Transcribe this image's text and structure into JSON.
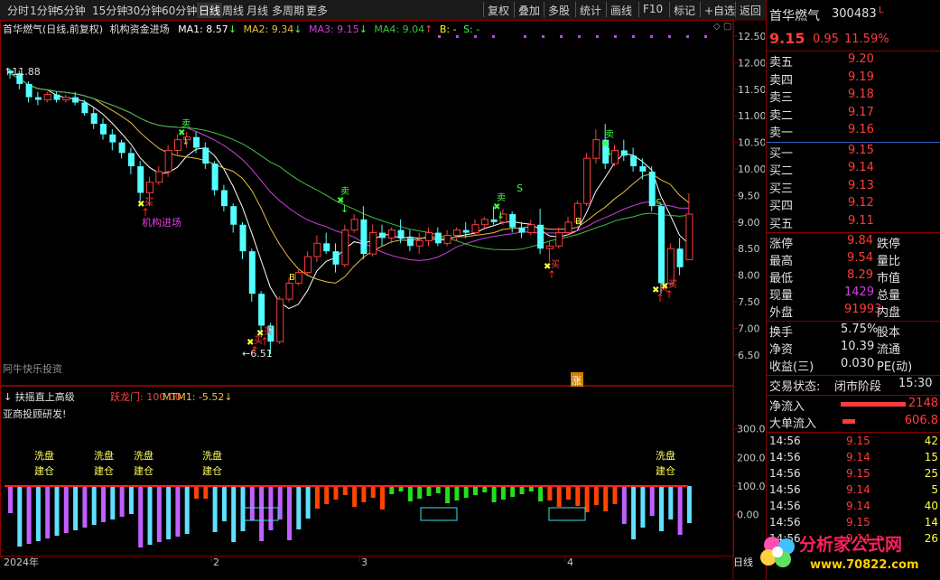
{
  "toolbar": {
    "left": [
      "分时",
      "1分钟",
      "5分钟",
      "15分钟",
      "30分钟",
      "60分钟",
      "日线",
      "周线",
      "月线",
      "多周期",
      "更多"
    ],
    "active": "日线",
    "right": [
      "复权",
      "叠加",
      "多股",
      "统计",
      "画线",
      "F10",
      "标记",
      "+自选",
      "返回"
    ]
  },
  "header": {
    "title": "首华燃气(日线,前复权)",
    "indicator": "机构资金进场",
    "ma1": "MA1: 8.57",
    "ma2": "MA2: 9.34",
    "ma3": "MA3: 9.15",
    "ma4": "MA4: 9.04",
    "b": "B: -",
    "s": "S: -"
  },
  "price_axis": [
    "12.50",
    "12.00",
    "11.50",
    "11.00",
    "10.50",
    "10.00",
    "9.50",
    "9.00",
    "8.50",
    "8.00",
    "7.50",
    "7.00",
    "6.50"
  ],
  "sub_axis": [
    "300.0",
    "200.0",
    "100.0",
    "0.00"
  ],
  "annotations": {
    "high": "11.88",
    "low": "6.51",
    "jigou": "机构进场",
    "watermark": "阿牛快乐投资",
    "zhang": "涨",
    "buy": "买",
    "sell": "卖",
    "s_mark": "S",
    "b_mark": "B"
  },
  "sub_header": {
    "name": "扶摇直上高级",
    "tag": "跃龙门: 100.00",
    "mtm": "MTM1: -5.52",
    "note": "亚商投顾研发!"
  },
  "xipan": [
    "洗盘",
    "建仓"
  ],
  "x_axis": [
    "2024年",
    "2",
    "3",
    "4"
  ],
  "day_label": "日线",
  "quote": {
    "name": "首华燃气",
    "code": "300483",
    "price": "9.15",
    "change": "0.95",
    "pct": "11.59%",
    "asks": [
      [
        "卖五",
        "9.20"
      ],
      [
        "卖四",
        "9.19"
      ],
      [
        "卖三",
        "9.18"
      ],
      [
        "卖二",
        "9.17"
      ],
      [
        "卖一",
        "9.16"
      ]
    ],
    "bids": [
      [
        "买一",
        "9.15"
      ],
      [
        "买二",
        "9.14"
      ],
      [
        "买三",
        "9.13"
      ],
      [
        "买四",
        "9.12"
      ],
      [
        "买五",
        "9.11"
      ]
    ],
    "stats": [
      [
        "涨停",
        "9.84",
        "跌停"
      ],
      [
        "最高",
        "9.54",
        "量比"
      ],
      [
        "最低",
        "8.29",
        "市值"
      ],
      [
        "现量",
        "1429",
        "总量"
      ],
      [
        "外盘",
        "91993",
        "内盘"
      ]
    ],
    "stats2": [
      [
        "换手",
        "5.75%",
        "股本"
      ],
      [
        "净资",
        "10.39",
        "流通"
      ],
      [
        "收益(三)",
        "0.030",
        "PE(动)"
      ]
    ],
    "status_label": "交易状态:",
    "status": "闭市阶段",
    "time": "15:30",
    "flow": [
      [
        "净流入",
        "2148"
      ],
      [
        "大单流入",
        "606.8"
      ]
    ],
    "ticks": [
      [
        "14:56",
        "9.15",
        "42"
      ],
      [
        "14:56",
        "9.14",
        "15"
      ],
      [
        "14:56",
        "9.15",
        "25"
      ],
      [
        "14:56",
        "9.14",
        "5"
      ],
      [
        "14:56",
        "9.14",
        "40"
      ],
      [
        "14:56",
        "9.15",
        "14"
      ],
      [
        "14:56",
        "9.14",
        "26"
      ]
    ]
  },
  "brand": {
    "name": "分析家公式网",
    "url": "www.70822.com"
  },
  "colors": {
    "up": "#ff3c3c",
    "down": "#54ffff",
    "ma1": "#ffffff",
    "ma2": "#e8c040",
    "ma3": "#d040e0",
    "ma4": "#40c040"
  },
  "chart_data": {
    "type": "candlestick",
    "ylim": [
      6.3,
      12.6
    ],
    "candles": [
      [
        11.85,
        11.88,
        11.7,
        11.8
      ],
      [
        11.8,
        11.85,
        11.5,
        11.6
      ],
      [
        11.6,
        11.65,
        11.25,
        11.35
      ],
      [
        11.35,
        11.45,
        11.2,
        11.3
      ],
      [
        11.3,
        11.45,
        11.25,
        11.4
      ],
      [
        11.4,
        11.45,
        11.25,
        11.3
      ],
      [
        11.3,
        11.4,
        11.25,
        11.35
      ],
      [
        11.35,
        11.45,
        11.2,
        11.25
      ],
      [
        11.25,
        11.3,
        11.0,
        11.05
      ],
      [
        11.05,
        11.15,
        10.75,
        10.85
      ],
      [
        10.85,
        10.95,
        10.55,
        10.65
      ],
      [
        10.65,
        10.75,
        10.35,
        10.5
      ],
      [
        10.5,
        10.55,
        10.2,
        10.3
      ],
      [
        10.3,
        10.4,
        9.9,
        10.05
      ],
      [
        10.05,
        10.15,
        9.4,
        9.55
      ],
      [
        9.55,
        9.85,
        9.3,
        9.75
      ],
      [
        9.75,
        10.05,
        9.7,
        9.95
      ],
      [
        9.95,
        10.45,
        9.85,
        10.35
      ],
      [
        10.35,
        10.65,
        10.25,
        10.55
      ],
      [
        10.55,
        10.7,
        10.4,
        10.6
      ],
      [
        10.6,
        10.7,
        10.3,
        10.4
      ],
      [
        10.4,
        10.5,
        10.0,
        10.1
      ],
      [
        10.1,
        10.15,
        9.5,
        9.6
      ],
      [
        9.6,
        9.7,
        9.2,
        9.3
      ],
      [
        9.3,
        9.35,
        8.8,
        8.95
      ],
      [
        8.95,
        9.0,
        8.3,
        8.45
      ],
      [
        8.45,
        8.5,
        7.5,
        7.65
      ],
      [
        7.65,
        7.7,
        6.9,
        7.05
      ],
      [
        7.05,
        7.1,
        6.51,
        6.75
      ],
      [
        6.75,
        7.6,
        6.7,
        7.55
      ],
      [
        7.55,
        7.95,
        7.5,
        7.85
      ],
      [
        7.85,
        8.1,
        7.8,
        8.05
      ],
      [
        8.05,
        8.45,
        8.0,
        8.35
      ],
      [
        8.35,
        8.75,
        8.25,
        8.6
      ],
      [
        8.6,
        8.8,
        8.4,
        8.45
      ],
      [
        8.45,
        8.6,
        8.05,
        8.2
      ],
      [
        8.2,
        8.95,
        8.15,
        8.85
      ],
      [
        8.85,
        9.15,
        8.8,
        9.05
      ],
      [
        9.05,
        9.3,
        8.3,
        8.4
      ],
      [
        8.4,
        8.95,
        8.35,
        8.8
      ],
      [
        8.8,
        8.95,
        8.55,
        8.7
      ],
      [
        8.7,
        8.9,
        8.6,
        8.85
      ],
      [
        8.85,
        9.05,
        8.6,
        8.7
      ],
      [
        8.7,
        8.85,
        8.45,
        8.55
      ],
      [
        8.55,
        8.8,
        8.4,
        8.65
      ],
      [
        8.65,
        8.9,
        8.55,
        8.8
      ],
      [
        8.8,
        8.9,
        8.55,
        8.6
      ],
      [
        8.6,
        8.85,
        8.55,
        8.75
      ],
      [
        8.75,
        8.9,
        8.65,
        8.85
      ],
      [
        8.85,
        9.0,
        8.7,
        8.8
      ],
      [
        8.8,
        9.05,
        8.75,
        8.95
      ],
      [
        8.95,
        9.1,
        8.85,
        9.05
      ],
      [
        9.05,
        9.3,
        8.95,
        9.0
      ],
      [
        9.0,
        9.25,
        8.95,
        9.15
      ],
      [
        9.15,
        9.2,
        8.8,
        8.9
      ],
      [
        8.9,
        9.0,
        8.7,
        8.8
      ],
      [
        8.8,
        9.05,
        8.75,
        8.95
      ],
      [
        8.95,
        9.25,
        8.4,
        8.5
      ],
      [
        8.5,
        8.65,
        8.25,
        8.55
      ],
      [
        8.55,
        8.9,
        8.5,
        8.8
      ],
      [
        8.8,
        9.1,
        8.75,
        9.0
      ],
      [
        9.0,
        9.4,
        8.95,
        9.35
      ],
      [
        9.35,
        10.3,
        9.3,
        10.2
      ],
      [
        10.2,
        10.75,
        10.1,
        10.55
      ],
      [
        10.55,
        10.85,
        10.0,
        10.1
      ],
      [
        10.1,
        10.45,
        10.05,
        10.35
      ],
      [
        10.35,
        10.55,
        10.15,
        10.25
      ],
      [
        10.25,
        10.4,
        9.95,
        10.05
      ],
      [
        10.05,
        10.2,
        9.8,
        9.95
      ],
      [
        9.95,
        10.05,
        9.2,
        9.3
      ],
      [
        9.3,
        9.35,
        7.65,
        7.85
      ],
      [
        7.85,
        8.6,
        7.8,
        8.5
      ],
      [
        8.5,
        8.7,
        8.0,
        8.15
      ],
      [
        8.29,
        9.54,
        8.29,
        9.15
      ]
    ]
  }
}
